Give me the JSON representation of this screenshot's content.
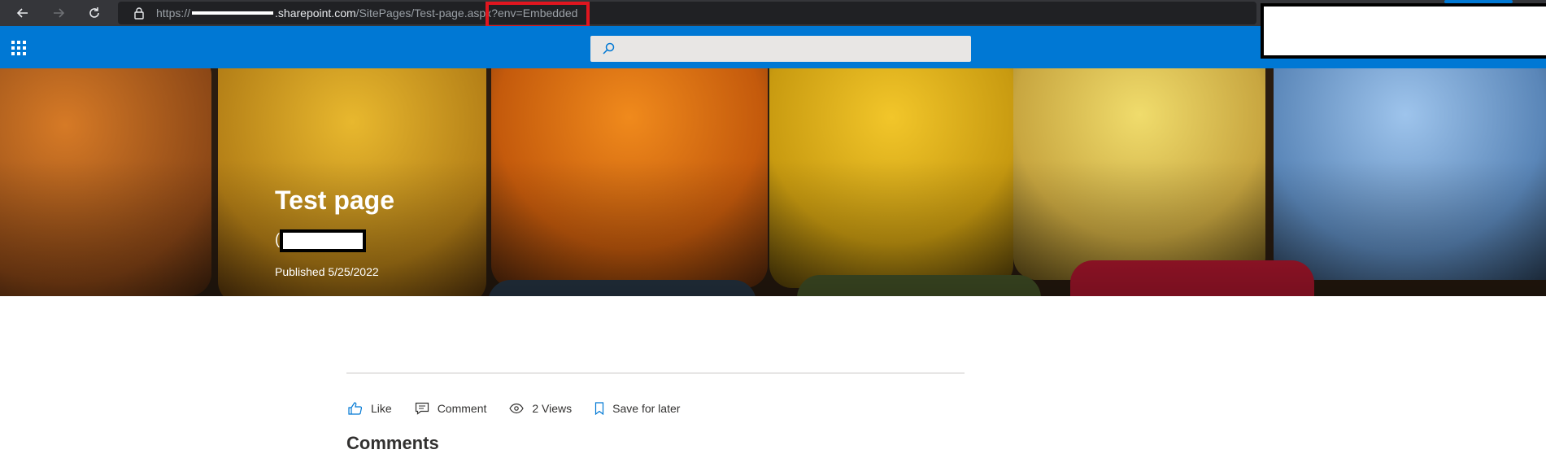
{
  "browser": {
    "url_prefix": "https://",
    "url_host": ".sharepoint.com",
    "url_path": "/SitePages/Test-page.aspx",
    "url_query": "?env=Embedded"
  },
  "suitebar": {
    "accent": "#0078d4",
    "search_placeholder": ""
  },
  "hero": {
    "title": "Test page",
    "published": "Published 5/25/2022"
  },
  "actions": {
    "like": "Like",
    "comment": "Comment",
    "views": "2 Views",
    "save": "Save for later"
  },
  "comments": {
    "heading": "Comments"
  },
  "colors": {
    "highlight": "#e0161f",
    "chrome": "#35363a"
  }
}
